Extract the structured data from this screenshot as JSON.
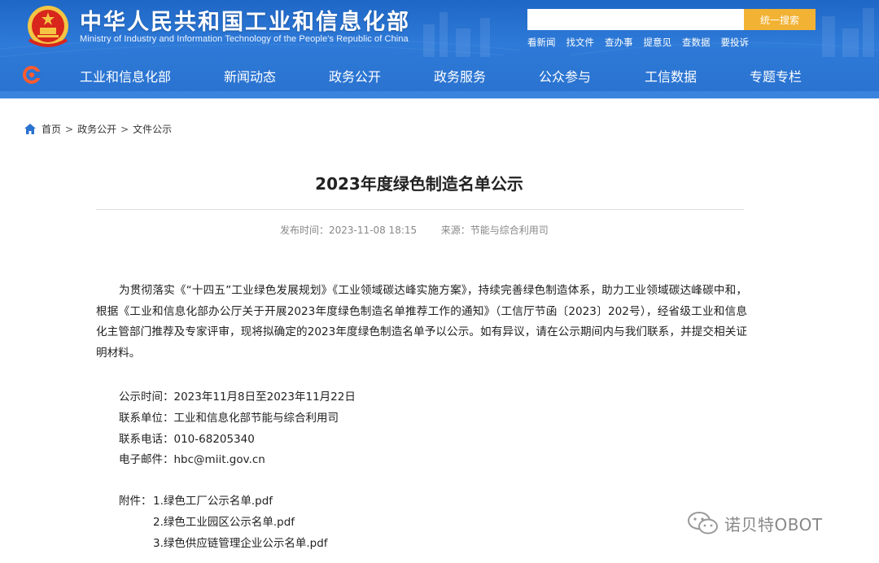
{
  "header": {
    "site_title": "中华人民共和国工业和信息化部",
    "site_subtitle": "Ministry of Industry and Information Technology of the People's Republic of China",
    "search_placeholder": "",
    "search_button": "统一搜索",
    "quick_links": [
      "看新闻",
      "找文件",
      "查办事",
      "提意见",
      "查数据",
      "要投诉"
    ]
  },
  "nav": {
    "items": [
      "工业和信息化部",
      "新闻动态",
      "政务公开",
      "政务服务",
      "公众参与",
      "工信数据",
      "专题专栏"
    ]
  },
  "breadcrumb": {
    "items": [
      "首页",
      "政务公开",
      "文件公示"
    ],
    "separator": ">"
  },
  "article": {
    "title": "2023年度绿色制造名单公示",
    "publish_time": "发布时间：2023-11-08 18:15",
    "source": "来源：节能与综合利用司",
    "paragraph": "为贯彻落实《“十四五”工业绿色发展规划》《工业领域碳达峰实施方案》，持续完善绿色制造体系，助力工业领域碳达峰碳中和，根据《工业和信息化部办公厅关于开展2023年度绿色制造名单推荐工作的通知》（工信厅节函〔2023〕202号），经省级工业和信息化主管部门推荐及专家评审，现将拟确定的2023年度绿色制造名单予以公示。如有异议，请在公示期间内与我们联系，并提交相关证明材料。",
    "info": [
      "公示时间：2023年11月8日至2023年11月22日",
      "联系单位：工业和信息化部节能与综合利用司",
      "联系电话：010-68205340",
      "电子邮件：hbc@miit.gov.cn"
    ],
    "attachments_label": "附件：",
    "attachments": [
      "1.绿色工厂公示名单.pdf",
      "2.绿色工业园区公示名单.pdf",
      "3.绿色供应链管理企业公示名单.pdf"
    ]
  },
  "watermark": {
    "text": "诺贝特OBOT"
  },
  "colors": {
    "header_blue": "#2a72cf",
    "search_button": "#f2b233",
    "emblem_red": "#d8261c",
    "emblem_gold": "#f3c543"
  }
}
